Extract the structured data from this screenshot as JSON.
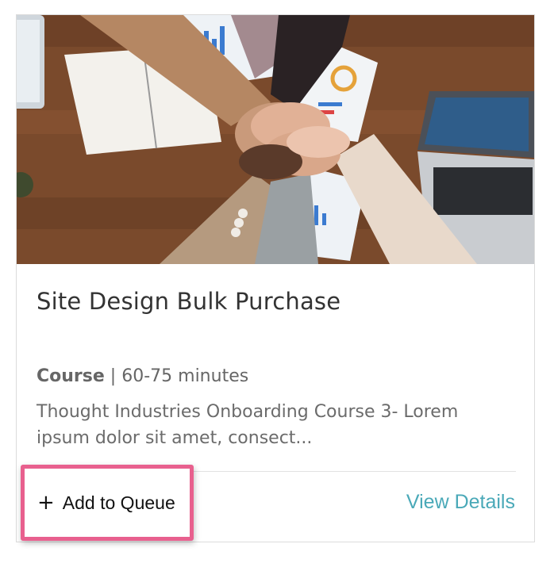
{
  "card": {
    "image_alt": "Team stacking hands over desk with laptop and charts",
    "title": "Site Design Bulk Purchase",
    "type": "Course",
    "separator": "|",
    "duration": "60-75 minutes",
    "description": "Thought Industries Onboarding Course 3- Lorem ipsum dolor sit amet, consect...",
    "add_to_queue_label": "Add to Queue",
    "add_icon": "plus-icon",
    "view_details_label": "View Details"
  },
  "colors": {
    "highlight_border": "#e8608e",
    "link": "#4aa9b8",
    "title_text": "#333333",
    "body_text": "#6b6b6b"
  }
}
